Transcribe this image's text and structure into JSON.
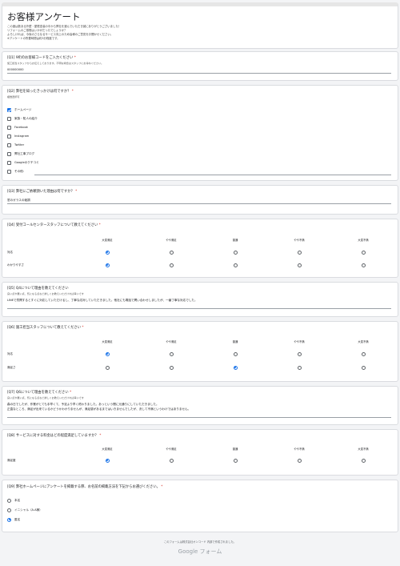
{
  "header": {
    "title": "お客様アンケート",
    "intro": [
      "この度は数ある外壁・屋根塗装の中から弊社を選んでいただき誠にありがとうございました！",
      "リフォームのご感想はいかがだったでしょうか？",
      "よろしければ、今後のさらなるサービス向上のため皆様のご意見をお聞かせください。",
      "※アンケートの所要時間は約3分程度です。"
    ]
  },
  "q1": {
    "title": "[Q1] 9桁のお客様コードをご入力ください",
    "sub": "施工担当スタッフからお伝えしております。不明な場合はスタッフにお尋ねください。",
    "value": "000000000"
  },
  "q2": {
    "title": "[Q2] 弊社を知ったきっかけは何ですか？",
    "sub": "複数選択可",
    "options": [
      {
        "label": "ホームページ",
        "checked": true
      },
      {
        "label": "家族・知人の紹介",
        "checked": false
      },
      {
        "label": "Facebook",
        "checked": false
      },
      {
        "label": "Instagram",
        "checked": false
      },
      {
        "label": "Twitter",
        "checked": false
      },
      {
        "label": "弊社工事ブログ",
        "checked": false
      },
      {
        "label": "Googleのクチコミ",
        "checked": false
      },
      {
        "label": "その他:",
        "checked": false
      }
    ]
  },
  "q3": {
    "title": "[Q3] 弊社にご依頼頂いた理由は何ですか？",
    "value": "窓のガラスの破損"
  },
  "q4": {
    "title": "[Q4] 受付コールセンタースタッフについて教えてください",
    "columns": [
      "大変満足",
      "やや満足",
      "普通",
      "やや不満",
      "大変不満"
    ],
    "rows": [
      {
        "label": "対応",
        "selected": 0
      },
      {
        "label": "わかりやすさ",
        "selected": 0
      }
    ]
  },
  "q5": {
    "title": "[Q5] Q4について理由を教えてください",
    "sub": "良い点や悪い点、気になる点など詳しくお教えいただければ幸いです",
    "value": "LINEで質問するとすぐに対応していただけるし、丁寧な応対していただきました。他社にも電話で問い合わせしましたが、一番丁寧な対応でした。"
  },
  "q6": {
    "title": "[Q6] 施工担当スタッフについて教えてください",
    "columns": [
      "大変満足",
      "やや満足",
      "普通",
      "やや不満",
      "大変不満"
    ],
    "rows": [
      {
        "label": "対応",
        "selected": 0
      },
      {
        "label": "満足さ",
        "selected": 2
      }
    ]
  },
  "q7": {
    "title": "[Q7] Q6について理由を教えてください",
    "sub": "良い点や悪い点、気になる点など詳しくお教えいただければ幸いです",
    "value_lines": [
      "森の日でしたが、作業がとても手早くて、予定より早く終わりました。あっという間に元通りにしていただきました。",
      "正直なところ、満足が出来ているかどうかわかりませんが、満足感があるまではいきませんでしたが、決して不満というわけではありません。"
    ]
  },
  "q8": {
    "title": "[Q8] サービスに対する料金はどの程度満足していますか？",
    "columns": [
      "大変満足",
      "やや満足",
      "普通",
      "やや不満",
      "大変不満"
    ],
    "rows": [
      {
        "label": "満足度",
        "selected": 0
      }
    ]
  },
  "q9": {
    "title": "[Q9] 弊社ホームページにアンケートを掲載する際、お名前の掲載方法を下記からお選びください。",
    "options": [
      {
        "label": "本名",
        "checked": false
      },
      {
        "label": "イニシャル（A.A様）",
        "checked": false
      },
      {
        "label": "匿名",
        "checked": true
      }
    ]
  },
  "footer": {
    "note": "このフォームは株式会社オンコード 内部で作成されました。",
    "brand": "Google フォーム"
  },
  "required_mark": "*",
  "colors": {
    "accent": "#1a73e8",
    "required": "#d93025",
    "background": "#f3f4f6"
  }
}
